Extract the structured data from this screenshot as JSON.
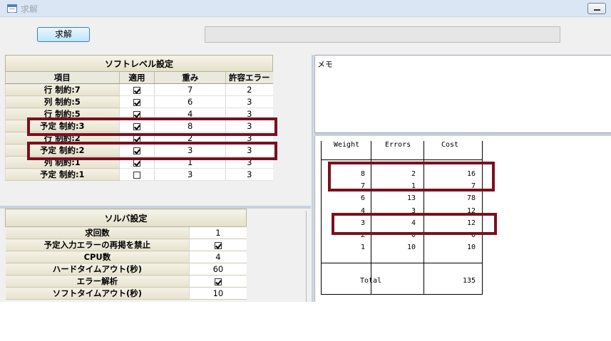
{
  "window": {
    "title": "求解"
  },
  "toolbar": {
    "solve_label": "求解"
  },
  "soft_level": {
    "title": "ソフトレベル設定",
    "columns": [
      "項目",
      "適用",
      "重み",
      "許容エラー"
    ],
    "rows": [
      {
        "name": "行 制約:7",
        "applied": true,
        "weight": "7",
        "errors": "2"
      },
      {
        "name": "列 制約:5",
        "applied": true,
        "weight": "6",
        "errors": "3"
      },
      {
        "name": "行 制約:5",
        "applied": true,
        "weight": "4",
        "errors": "3"
      },
      {
        "name": "予定 制約:3",
        "applied": true,
        "weight": "8",
        "errors": "3"
      },
      {
        "name": "行 制約:2",
        "applied": true,
        "weight": "2",
        "errors": "3"
      },
      {
        "name": "予定 制約:2",
        "applied": true,
        "weight": "3",
        "errors": "3"
      },
      {
        "name": "列 制約:1",
        "applied": true,
        "weight": "1",
        "errors": "3"
      },
      {
        "name": "予定 制約:1",
        "applied": false,
        "weight": "3",
        "errors": "3"
      }
    ]
  },
  "solver": {
    "title": "ソルバ設定",
    "rows": [
      {
        "name": "求回数",
        "value": "1",
        "is_check": false
      },
      {
        "name": "予定入力エラーの再掲を禁止",
        "value": "",
        "is_check": true,
        "checked": true
      },
      {
        "name": "CPU数",
        "value": "4",
        "is_check": false
      },
      {
        "name": "ハードタイムアウト(秒)",
        "value": "60",
        "is_check": false
      },
      {
        "name": "エラー解析",
        "value": "",
        "is_check": true,
        "checked": true
      },
      {
        "name": "ソフトタイムアウト(秒)",
        "value": "10",
        "is_check": false
      }
    ]
  },
  "memo": {
    "label": "メモ"
  },
  "result": {
    "headers": [
      "Weight",
      "Errors",
      "Cost"
    ],
    "rows": [
      {
        "weight": "8",
        "errors": "2",
        "cost": "16"
      },
      {
        "weight": "7",
        "errors": "1",
        "cost": "7"
      },
      {
        "weight": "6",
        "errors": "13",
        "cost": "78"
      },
      {
        "weight": "4",
        "errors": "3",
        "cost": "12"
      },
      {
        "weight": "3",
        "errors": "4",
        "cost": "12"
      },
      {
        "weight": "2",
        "errors": "0",
        "cost": "0"
      },
      {
        "weight": "1",
        "errors": "10",
        "cost": "10"
      }
    ],
    "total_label": "Total",
    "total_value": "135"
  },
  "colors": {
    "highlight": "#7a1020",
    "titlebar": "#dbe6f4",
    "button": "#bee6fd"
  }
}
